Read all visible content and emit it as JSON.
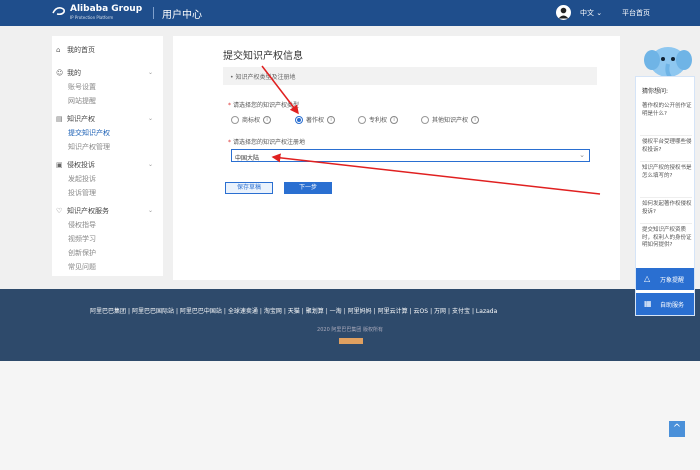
{
  "header": {
    "logo_text": "Alibaba Group",
    "logo_subtitle": "IP Protection Platform",
    "title": "用户中心",
    "language": "中文 ⌄",
    "workbench": "平台首页"
  },
  "sidebar": {
    "home": "我的首页",
    "sections": [
      {
        "label": "我的",
        "items": [
          "账号设置",
          "网站提醒"
        ]
      },
      {
        "label": "知识产权",
        "items": [
          "提交知识产权",
          "知识产权管理"
        ]
      },
      {
        "label": "侵权投诉",
        "items": [
          "发起投诉",
          "投诉管理"
        ]
      },
      {
        "label": "知识产权服务",
        "items": [
          "侵权指导",
          "视频学习",
          "创新保护",
          "常见问题"
        ]
      }
    ]
  },
  "form": {
    "title": "提交知识产权信息",
    "step_label": "• 知识产权类型及注册地",
    "type_question": "请选择您的知识产权类型",
    "type_options": [
      "商标权",
      "著作权",
      "专利权",
      "其他知识产权"
    ],
    "type_selected": "著作权",
    "region_question": "请选择您的知识产权注册地",
    "region_value": "中国大陆",
    "save_label": "保存草稿",
    "next_label": "下一步"
  },
  "footer": {
    "links": [
      "阿里巴巴集团",
      "阿里巴巴国际站",
      "阿里巴巴中国站",
      "全球速卖通",
      "淘宝网",
      "天猫",
      "聚划算",
      "一淘",
      "阿里妈妈",
      "阿里云计算",
      "云OS",
      "万网",
      "支付宝",
      "Lazada"
    ],
    "copyright": "2020 阿里巴巴集团 版权所有"
  },
  "helper": {
    "title": "猜你想问:",
    "questions": [
      "著作权的公开创作证明是什么?",
      "侵权平台受理哪些侵权投诉?",
      "知识产权的授权书是怎么填写的?",
      "如何发起著作权侵权投诉?",
      "提交知识产权资质时，权利人的身份证明如何提供?"
    ],
    "btn_help": "万象提醒",
    "btn_self": "自助服务"
  },
  "colors": {
    "header_bg": "#1f4e8c",
    "primary": "#2a6fd1",
    "footer_bg": "#2e4a6b",
    "annotation": "#e02020"
  }
}
